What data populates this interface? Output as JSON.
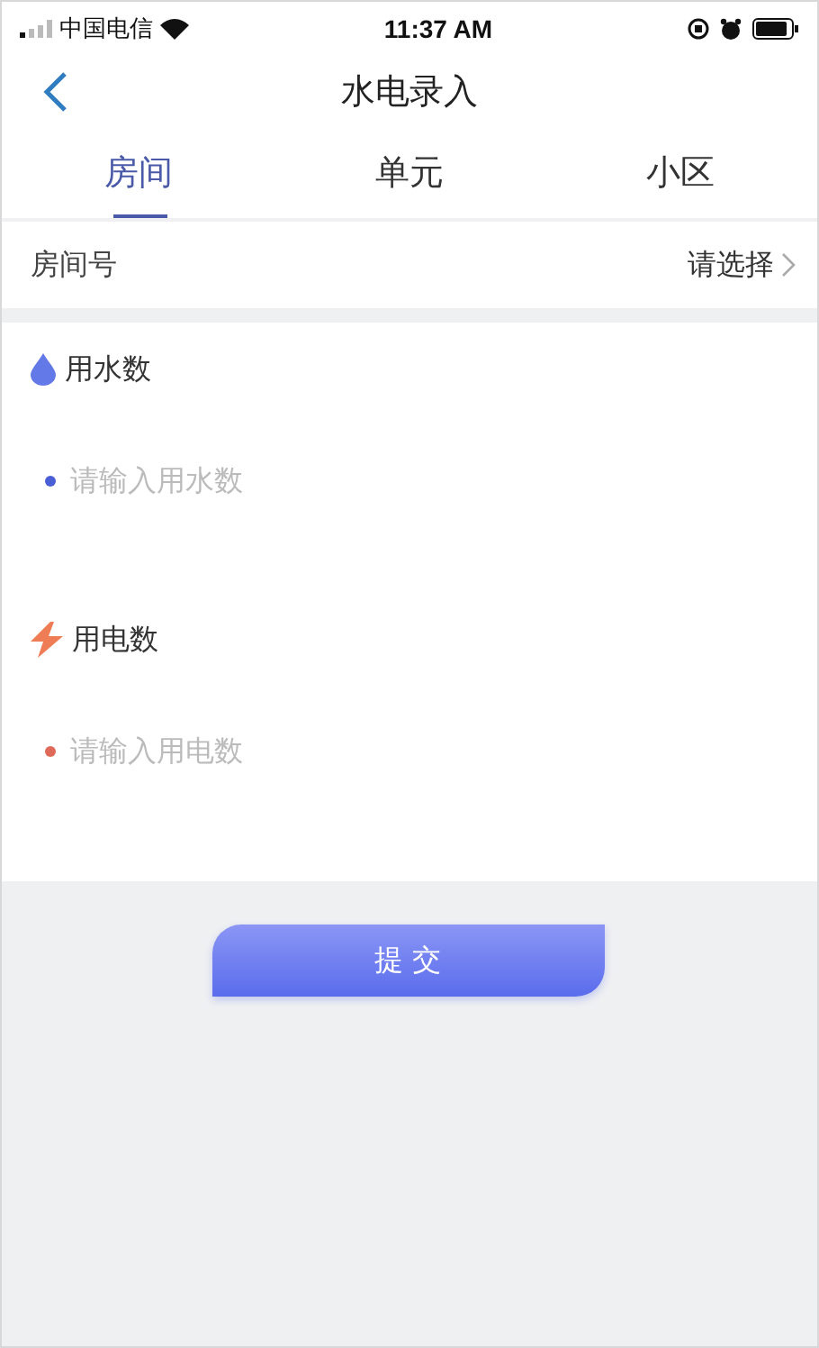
{
  "status_bar": {
    "carrier": "中国电信",
    "time": "11:37 AM"
  },
  "nav": {
    "title": "水电录入"
  },
  "tabs": [
    {
      "label": "房间",
      "selected": true
    },
    {
      "label": "单元",
      "selected": false
    },
    {
      "label": "小区",
      "selected": false
    }
  ],
  "room_row": {
    "label": "房间号",
    "value": "请选择"
  },
  "fields": [
    {
      "kind": "water",
      "label": "用水数",
      "placeholder": "请输入用水数",
      "color": "#4a5fd6"
    },
    {
      "kind": "electricity",
      "label": "用电数",
      "placeholder": "请输入用电数",
      "color": "#e06a5a"
    }
  ],
  "submit": {
    "label": "提 交"
  }
}
